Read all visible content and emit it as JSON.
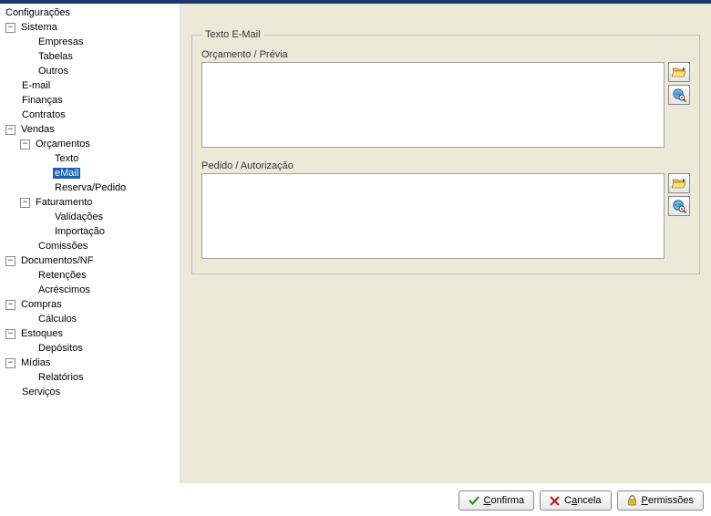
{
  "tree": {
    "root": "Configurações",
    "sistema": "Sistema",
    "empresas": "Empresas",
    "tabelas": "Tabelas",
    "outros": "Outros",
    "email": "E-mail",
    "financas": "Finanças",
    "contratos": "Contratos",
    "vendas": "Vendas",
    "orcamentos": "Orçamentos",
    "texto": "Texto",
    "orc_email": "eMail",
    "reserva_pedido": "Reserva/Pedido",
    "faturamento": "Faturamento",
    "validacoes": "Validações",
    "importacao": "Importação",
    "comissoes": "Comissões",
    "documentos_nf": "Documentos/NF",
    "retencoes": "Retenções",
    "acrescimos": "Acréscimos",
    "compras": "Compras",
    "calculos": "Cálculos",
    "estoques": "Estoques",
    "depositos": "Depósitos",
    "midias": "Mídias",
    "relatorios": "Relatórios",
    "servicos": "Serviços"
  },
  "toggle": {
    "minus": "⊟",
    "plus": "⊞"
  },
  "panel": {
    "group_title": "Texto E-Mail",
    "field1_label": "Orçamento / Prévia",
    "field1_value": "",
    "field2_label": "Pedido / Autorização",
    "field2_value": ""
  },
  "buttons": {
    "confirma": "Confirma",
    "cancela": "Cancela",
    "permissoes": "Permissões"
  }
}
